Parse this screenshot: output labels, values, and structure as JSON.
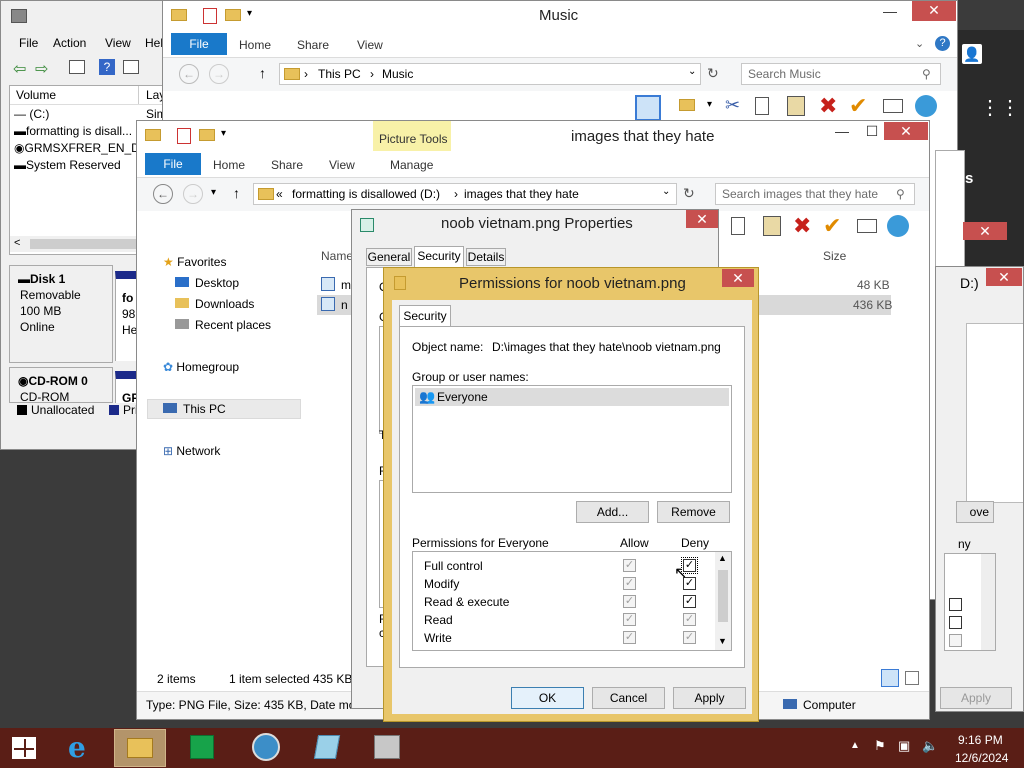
{
  "disk_mgmt": {
    "menu": [
      "File",
      "Action",
      "View",
      "Hel"
    ],
    "columns": [
      "Volume",
      "Lay"
    ],
    "volumes": [
      {
        "name": "(C:)",
        "layout": "Sim"
      },
      {
        "name": "formatting is disall...",
        "layout": ""
      },
      {
        "name": "GRMSXFRER_EN_D...",
        "layout": ""
      },
      {
        "name": "System Reserved",
        "layout": ""
      }
    ],
    "disk1": {
      "name": "Disk 1",
      "type": "Removable",
      "size": "100 MB",
      "status": "Online",
      "part_lines": [
        "fo",
        "98",
        "He"
      ]
    },
    "cdrom0": {
      "name": "CD-ROM 0",
      "type": "CD-ROM",
      "part_line": "GF"
    },
    "legend": [
      "Unallocated",
      "Prin"
    ]
  },
  "music_window": {
    "title": "Music",
    "tabs": {
      "file": "File",
      "home": "Home",
      "share": "Share",
      "view": "View"
    },
    "breadcrumb": [
      "This PC",
      "Music"
    ],
    "search_placeholder": "Search Music"
  },
  "images_window": {
    "title": "images that they hate",
    "picture_tools": "Picture Tools",
    "tabs": {
      "file": "File",
      "home": "Home",
      "share": "Share",
      "view": "View",
      "manage": "Manage"
    },
    "breadcrumb": [
      "«",
      "formatting is disallowed (D:)",
      "images that they hate"
    ],
    "search_placeholder": "Search images that they hate",
    "nav": {
      "favorites": "Favorites",
      "desktop": "Desktop",
      "downloads": "Downloads",
      "recent": "Recent places",
      "homegroup": "Homegroup",
      "thispc": "This PC",
      "network": "Network"
    },
    "columns": {
      "name": "Name",
      "size": "Size"
    },
    "files": [
      {
        "name": "m",
        "size": "48 KB"
      },
      {
        "name": "n",
        "size": "436 KB"
      }
    ],
    "status_items": "2 items",
    "status_selected": "1 item selected  435 KB",
    "details_bar": "Type: PNG File, Size: 435 KB, Date modi",
    "computer": "Computer"
  },
  "properties": {
    "title": "noob vietnam.png Properties",
    "tabs": [
      "General",
      "Security",
      "Details"
    ],
    "left_letters": [
      "O",
      "G",
      "T",
      "F",
      "F",
      "c"
    ]
  },
  "right_dialog": {
    "title_frag": "D:)",
    "remove": "ove",
    "deny_frag": "ny",
    "apply": "Apply"
  },
  "permissions": {
    "title": "Permissions for noob vietnam.png",
    "tab": "Security",
    "object_label": "Object name:",
    "object_value": "D:\\images that they hate\\noob vietnam.png",
    "group_label": "Group or user names:",
    "users": [
      "Everyone"
    ],
    "add": "Add...",
    "remove": "Remove",
    "perm_label": "Permissions for Everyone",
    "allow": "Allow",
    "deny": "Deny",
    "perms": [
      {
        "name": "Full control",
        "allow": true,
        "deny": true
      },
      {
        "name": "Modify",
        "allow": true,
        "deny": true
      },
      {
        "name": "Read & execute",
        "allow": true,
        "deny": true
      },
      {
        "name": "Read",
        "allow": true,
        "deny": true
      },
      {
        "name": "Write",
        "allow": true,
        "deny": true
      }
    ],
    "ok": "OK",
    "cancel": "Cancel",
    "apply": "Apply"
  },
  "tray": {
    "time": "9:16 PM",
    "date": "12/6/2024"
  },
  "colors": {
    "accent": "#1979ca",
    "dialog_frame": "#e8c66a",
    "close": "#c7504f",
    "taskbar": "#5a1e16"
  }
}
